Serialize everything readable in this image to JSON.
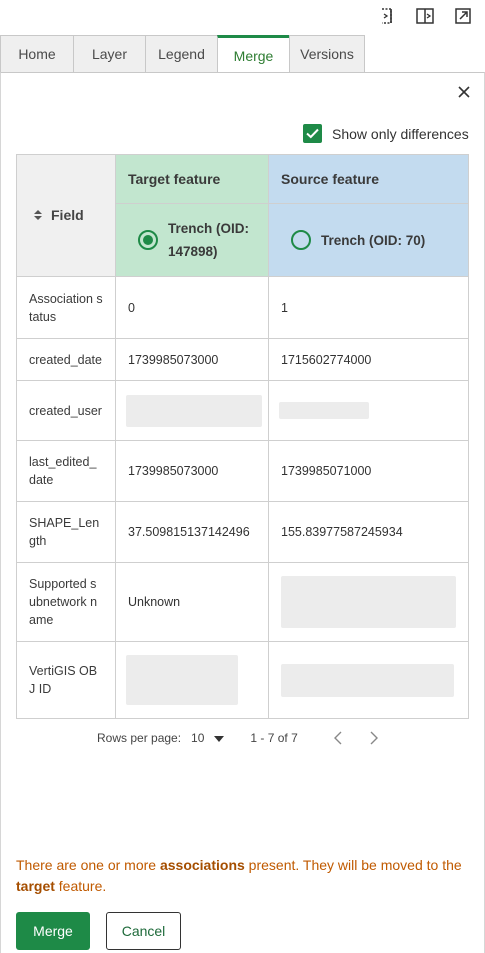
{
  "toolbar_icons": [
    "dock-left-icon",
    "split-view-icon",
    "pop-out-icon"
  ],
  "tabs": [
    {
      "label": "Home",
      "active": false
    },
    {
      "label": "Layer",
      "active": false
    },
    {
      "label": "Legend",
      "active": false
    },
    {
      "label": "Merge",
      "active": true
    },
    {
      "label": "Versions",
      "active": false
    }
  ],
  "options": {
    "show_only_differences_label": "Show only differences",
    "show_only_differences_checked": true
  },
  "table": {
    "field_header": "Field",
    "target_header": "Target feature",
    "source_header": "Source feature",
    "target_option": "Trench (OID: 147898)",
    "source_option": "Trench (OID: 70)",
    "target_selected": true,
    "rows": [
      {
        "field": "Association status",
        "target": "0",
        "source": "1"
      },
      {
        "field": "created_date",
        "target": "1739985073000",
        "source": "1715602774000"
      },
      {
        "field": "created_user",
        "target": "",
        "source": ""
      },
      {
        "field": "last_edited_date",
        "target": "1739985073000",
        "source": "1739985071000"
      },
      {
        "field": "SHAPE_Length",
        "target": "37.509815137142496",
        "source": "155.83977587245934"
      },
      {
        "field": "Supported subnetwork name",
        "target": "Unknown",
        "source": ""
      },
      {
        "field": "VertiGIS OBJ ID",
        "target": "",
        "source": ""
      }
    ]
  },
  "pager": {
    "rows_per_page_label": "Rows per page:",
    "rows_per_page_value": "10",
    "range": "1 - 7 of 7"
  },
  "notice": {
    "part1": "There are one or more ",
    "bold1": "associations",
    "part2": " present. They will be moved to the ",
    "bold2": "target",
    "part3": " feature."
  },
  "buttons": {
    "merge": "Merge",
    "cancel": "Cancel"
  },
  "colors": {
    "accent": "#1e8a47",
    "target_bg": "#c2e6cf",
    "source_bg": "#c3dbef",
    "notice": "#c05a00"
  }
}
